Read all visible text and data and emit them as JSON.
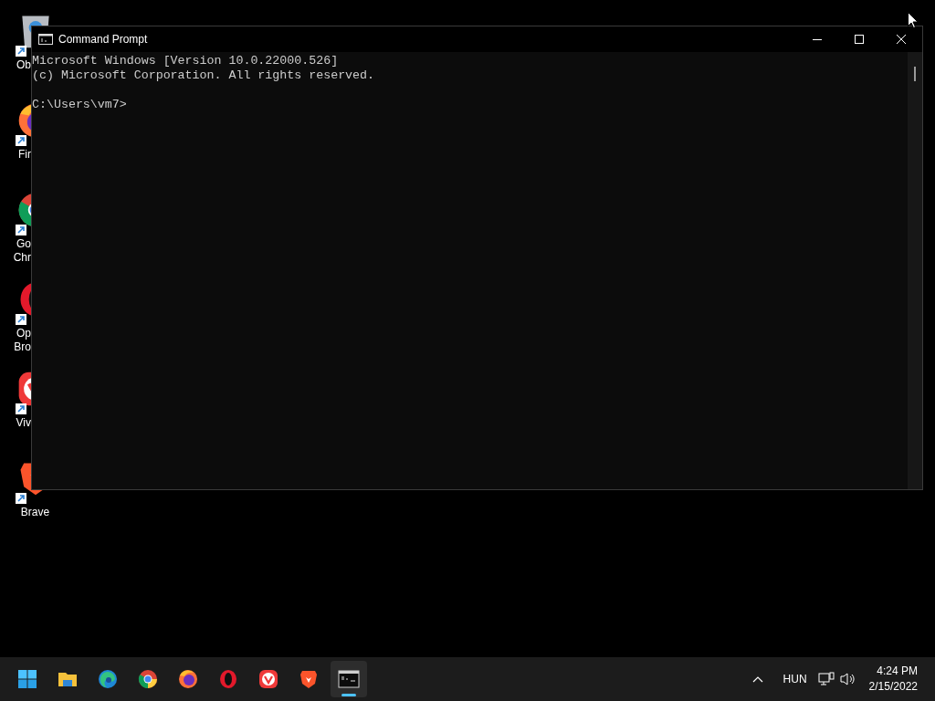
{
  "desktop_icons": [
    {
      "kind": "bin",
      "covered": true,
      "label_lines": [
        "Ob"
      ]
    },
    {
      "kind": "firefox",
      "covered": true,
      "label_lines": [
        "Fir"
      ]
    },
    {
      "kind": "chrome",
      "covered": true,
      "label_lines": [
        "Go",
        "Chr"
      ]
    },
    {
      "kind": "opera",
      "covered": true,
      "label_lines": [
        "Op",
        "Bro"
      ]
    },
    {
      "kind": "vivaldi",
      "covered": true,
      "label_lines": [
        "Viv"
      ]
    },
    {
      "kind": "brave",
      "covered": false,
      "label_lines": [
        "Brave"
      ]
    }
  ],
  "window": {
    "title": "Command Prompt",
    "output_lines": [
      "Microsoft Windows [Version 10.0.22000.526]",
      "(c) Microsoft Corporation. All rights reserved."
    ],
    "prompt": "C:\\Users\\vm7>"
  },
  "taskbar": {
    "apps": [
      {
        "kind": "start",
        "selected": false
      },
      {
        "kind": "folder",
        "selected": false
      },
      {
        "kind": "edge",
        "selected": false
      },
      {
        "kind": "chrome",
        "selected": false
      },
      {
        "kind": "firefox",
        "selected": false
      },
      {
        "kind": "opera",
        "selected": false
      },
      {
        "kind": "vivaldi",
        "selected": false
      },
      {
        "kind": "brave",
        "selected": false
      },
      {
        "kind": "terminal",
        "selected": true
      }
    ],
    "language": "HUN",
    "time": "4:24 PM",
    "date": "2/15/2022"
  }
}
